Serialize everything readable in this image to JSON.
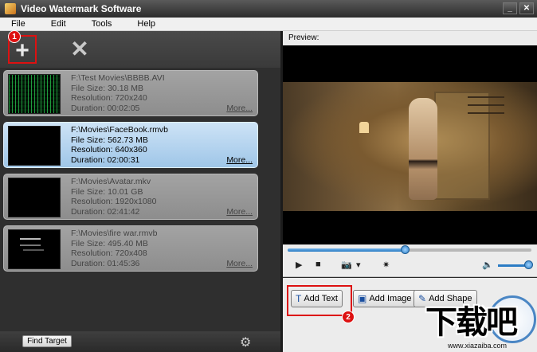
{
  "window": {
    "title": "Video Watermark Software",
    "controls": [
      "_",
      "✕"
    ]
  },
  "menu": [
    "File",
    "Edit",
    "Tools",
    "Help"
  ],
  "toolbar": {
    "add_icon": "+",
    "remove_icon": "✕",
    "badge_1": "1"
  },
  "files": [
    {
      "path": "F:\\Test Movies\\BBBB.AVI",
      "size": "File Size: 30.18 MB",
      "res": "Resolution: 720x240",
      "dur": "Duration: 00:02:05",
      "more": "More...",
      "thumb": "matrix"
    },
    {
      "path": "F:\\Movies\\FaceBook.rmvb",
      "size": "File Size: 562.73 MB",
      "res": "Resolution: 640x360",
      "dur": "Duration: 02:00:31",
      "more": "More...",
      "thumb": "black"
    },
    {
      "path": "F:\\Movies\\Avatar.mkv",
      "size": "File Size: 10.01 GB",
      "res": "Resolution: 1920x1080",
      "dur": "Duration: 02:41:42",
      "more": "More...",
      "thumb": "black"
    },
    {
      "path": "F:\\Movies\\fire war.rmvb",
      "size": "File Size: 495.40 MB",
      "res": "Resolution: 720x408",
      "dur": "Duration: 01:45:36",
      "more": "More...",
      "thumb": "fire"
    }
  ],
  "selected_index": 1,
  "bottom": {
    "find_target": "Find Target",
    "settings_icon": "⚙"
  },
  "preview": {
    "label": "Preview:",
    "progress": 0.48
  },
  "player": {
    "play_icon": "▶",
    "stop_icon": "■",
    "camera_icon": "📷",
    "dropdown": "▾",
    "effect_icon": "✷",
    "volume_icon": "🔈",
    "volume": 1.0
  },
  "actions": {
    "add_text": "Add Text",
    "add_image": "Add Image",
    "add_shape": "Add Shape",
    "badge_2": "2",
    "text_icon": "T"
  },
  "watermark": {
    "logo_text": "下载吧",
    "url": "www.xiazaiba.com"
  }
}
